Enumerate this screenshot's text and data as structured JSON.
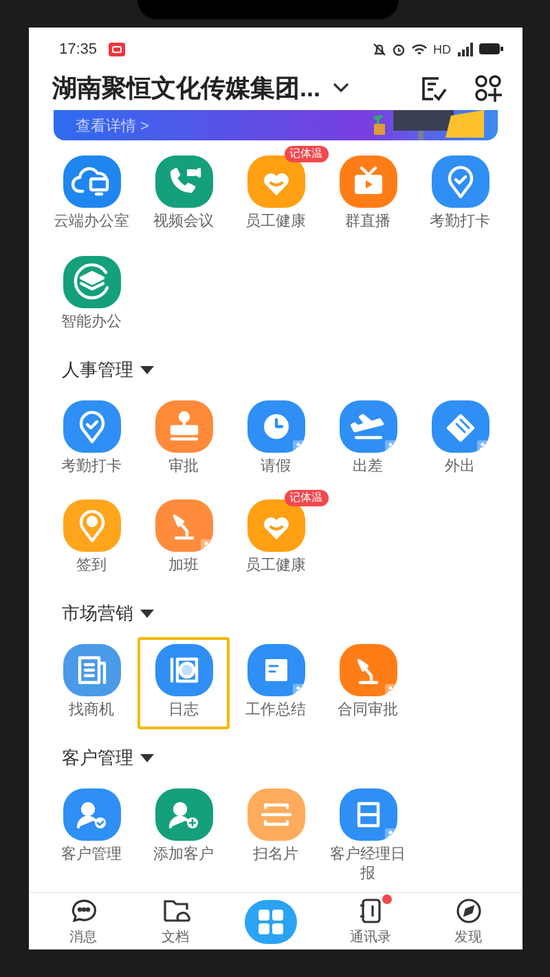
{
  "status_bar": {
    "time": "17:35",
    "recording": true,
    "network": "HD"
  },
  "header": {
    "title": "湖南聚恒文化传媒集团...",
    "expanded": false
  },
  "banner": {
    "link": "查看详情 >"
  },
  "sections": [
    {
      "items": [
        {
          "label": "云端办公室",
          "kind": "cloud",
          "color": "#1f86f0",
          "corner_mark": false,
          "selected": false
        },
        {
          "label": "视频会议",
          "kind": "phone",
          "color": "#14a07b",
          "corner_mark": false,
          "selected": false
        },
        {
          "label": "员工健康",
          "kind": "heart",
          "color": "#ff9f12",
          "corner_mark": false,
          "selected": false,
          "badge": "记体温"
        },
        {
          "label": "群直播",
          "kind": "tv",
          "color": "#ff7d17",
          "corner_mark": false,
          "selected": false
        },
        {
          "label": "考勤打卡",
          "kind": "pin",
          "color": "#2f8ff5",
          "corner_mark": false,
          "selected": false
        },
        {
          "label": "智能办公",
          "kind": "layers",
          "color": "#14a07b",
          "corner_mark": false,
          "selected": false
        }
      ]
    },
    {
      "heading": "人事管理",
      "expanded": true,
      "items": [
        {
          "label": "考勤打卡",
          "kind": "pin",
          "color": "#2f8ff5",
          "corner_mark": false,
          "selected": false
        },
        {
          "label": "审批",
          "kind": "stamp",
          "color": "#ff8a3a",
          "corner_mark": false,
          "selected": false
        },
        {
          "label": "请假",
          "kind": "clock",
          "color": "#2f8ff5",
          "corner_mark": true,
          "selected": false
        },
        {
          "label": "出差",
          "kind": "plane",
          "color": "#2f8ff5",
          "corner_mark": true,
          "selected": false
        },
        {
          "label": "外出",
          "kind": "ticket",
          "color": "#2f8ff5",
          "corner_mark": true,
          "selected": false
        },
        {
          "label": "签到",
          "kind": "location",
          "color": "#ffa51c",
          "corner_mark": false,
          "selected": false
        },
        {
          "label": "加班",
          "kind": "lamp",
          "color": "#ff8b3d",
          "corner_mark": true,
          "selected": false
        },
        {
          "label": "员工健康",
          "kind": "heart",
          "color": "#ff9f12",
          "corner_mark": false,
          "selected": false,
          "badge": "记体温"
        }
      ]
    },
    {
      "heading": "市场营销",
      "expanded": true,
      "items": [
        {
          "label": "找商机",
          "kind": "building",
          "color": "#4a9ae8",
          "corner_mark": false,
          "selected": false
        },
        {
          "label": "日志",
          "kind": "book",
          "color": "#2f8ff5",
          "corner_mark": false,
          "selected": true
        },
        {
          "label": "工作总结",
          "kind": "note",
          "color": "#2f8ff5",
          "corner_mark": true,
          "selected": false
        },
        {
          "label": "合同审批",
          "kind": "lamp",
          "color": "#ff7d17",
          "corner_mark": true,
          "selected": false
        }
      ]
    },
    {
      "heading": "客户管理",
      "expanded": true,
      "items": [
        {
          "label": "客户管理",
          "kind": "person-check",
          "color": "#2f8ff5",
          "corner_mark": false,
          "selected": false
        },
        {
          "label": "添加客户",
          "kind": "person-plus",
          "color": "#14a07b",
          "corner_mark": false,
          "selected": false
        },
        {
          "label": "扫名片",
          "kind": "scan",
          "color": "#ffab5c",
          "corner_mark": false,
          "selected": false
        },
        {
          "label": "客户经理日报",
          "kind": "calendar",
          "color": "#2f8ff5",
          "corner_mark": true,
          "selected": false
        }
      ]
    }
  ],
  "nav": [
    {
      "label": "消息",
      "kind": "chat",
      "dot": false
    },
    {
      "label": "文档",
      "kind": "folder",
      "dot": false
    },
    {
      "kind": "apps",
      "dot": false
    },
    {
      "label": "通讯录",
      "kind": "contacts",
      "dot": true
    },
    {
      "label": "发现",
      "kind": "compass",
      "dot": false
    }
  ]
}
